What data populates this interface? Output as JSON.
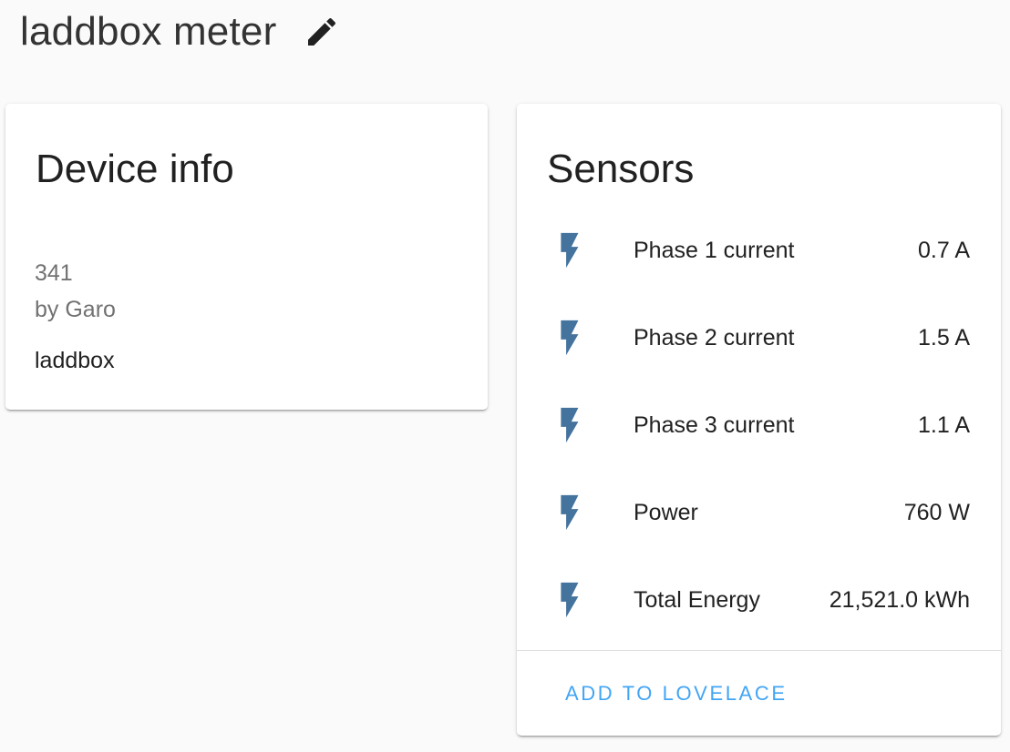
{
  "header": {
    "title": "laddbox meter",
    "edit_icon": "pencil-icon"
  },
  "device_info": {
    "title": "Device info",
    "model": "341",
    "manufacturer": "by Garo",
    "name": "laddbox"
  },
  "sensors": {
    "title": "Sensors",
    "icon": "flash-icon",
    "icon_color": "#44739e",
    "items": [
      {
        "label": "Phase 1 current",
        "value": "0.7 A"
      },
      {
        "label": "Phase 2 current",
        "value": "1.5 A"
      },
      {
        "label": "Phase 3 current",
        "value": "1.1 A"
      },
      {
        "label": "Power",
        "value": "760 W"
      },
      {
        "label": "Total Energy",
        "value": "21,521.0 kWh"
      }
    ],
    "action_label": "ADD TO LOVELACE",
    "action_color": "#42a5f5"
  }
}
